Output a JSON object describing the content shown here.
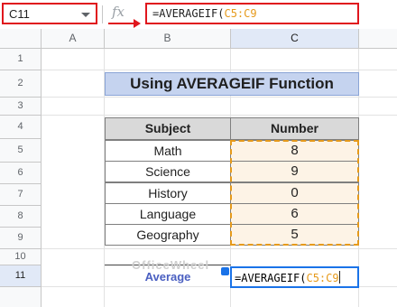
{
  "formula_bar": {
    "name_box": "C11",
    "fx_label": "fx",
    "formula_fn": "=AVERAGEIF(",
    "formula_range": "C5:C9"
  },
  "columns": [
    "A",
    "B",
    "C"
  ],
  "rows": [
    "1",
    "2",
    "3",
    "4",
    "5",
    "6",
    "7",
    "8",
    "9",
    "10",
    "11"
  ],
  "sheet": {
    "title": "Using AVERAGEIF Function",
    "table": {
      "headers": [
        "Subject",
        "Number"
      ],
      "rows": [
        {
          "subject": "Math",
          "number": "8"
        },
        {
          "subject": "Science",
          "number": "9"
        },
        {
          "subject": "History",
          "number": "0"
        },
        {
          "subject": "Language",
          "number": "6"
        },
        {
          "subject": "Geography",
          "number": "5"
        }
      ]
    },
    "average_label": "Average",
    "editing_fn": "=AVERAGEIF(",
    "editing_range": "C5:C9",
    "watermark": "OfficeWheel"
  },
  "colors": {
    "highlight_red": "#e0161d",
    "range_orange": "#e69a1b",
    "active_blue": "#1a73e8",
    "title_bg": "#c5d3ef",
    "label_blue": "#4a5fc1"
  },
  "icons": {
    "dropdown": "chevron-down-icon",
    "function": "fx-icon",
    "pointer": "arrow-icon"
  }
}
